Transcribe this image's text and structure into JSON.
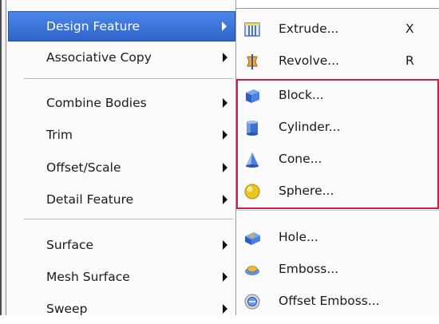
{
  "main_menu": {
    "items": [
      {
        "label": "Design Feature",
        "has_submenu": true,
        "selected": true
      },
      {
        "label": "Associative Copy",
        "has_submenu": true
      },
      {
        "label": "Combine Bodies",
        "has_submenu": true
      },
      {
        "label": "Trim",
        "has_submenu": true
      },
      {
        "label": "Offset/Scale",
        "has_submenu": true
      },
      {
        "label": "Detail Feature",
        "has_submenu": true
      },
      {
        "label": "Surface",
        "has_submenu": true
      },
      {
        "label": "Mesh Surface",
        "has_submenu": true
      },
      {
        "label": "Sweep",
        "has_submenu": true
      }
    ]
  },
  "submenu": {
    "items": [
      {
        "label": "Extrude...",
        "shortcut": "X",
        "icon": "extrude-icon"
      },
      {
        "label": "Revolve...",
        "shortcut": "R",
        "icon": "revolve-icon"
      },
      {
        "label": "Block...",
        "icon": "block-icon"
      },
      {
        "label": "Cylinder...",
        "icon": "cylinder-icon"
      },
      {
        "label": "Cone...",
        "icon": "cone-icon"
      },
      {
        "label": "Sphere...",
        "icon": "sphere-icon"
      },
      {
        "label": "Hole...",
        "icon": "hole-icon"
      },
      {
        "label": "Emboss...",
        "icon": "emboss-icon"
      },
      {
        "label": "Offset Emboss...",
        "icon": "offset-emboss-icon"
      }
    ]
  },
  "colors": {
    "selected_bg": "#3b73d8",
    "highlight_border": "#d11f4a"
  }
}
